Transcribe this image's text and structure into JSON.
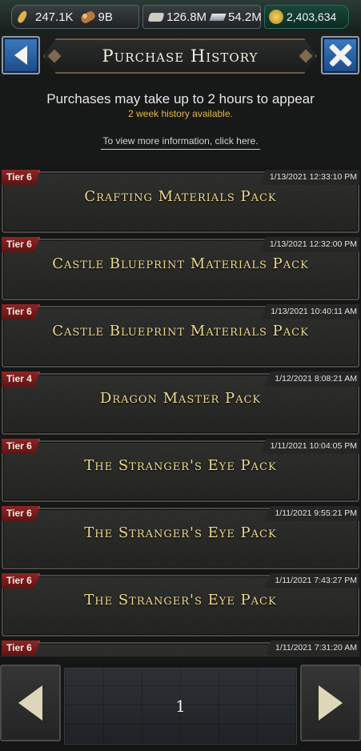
{
  "resources": {
    "food": "247.1K",
    "wood": "9B",
    "stone": "126.8M",
    "iron": "54.2M",
    "gold": "2,403,634"
  },
  "icons": {
    "back": "chevron-left-icon",
    "close": "close-icon",
    "prev_page": "arrow-left-icon",
    "next_page": "arrow-right-icon"
  },
  "header": {
    "title": "Purchase History"
  },
  "info": {
    "notice": "Purchases may take up to 2 hours to appear",
    "history_note": "2 week history available.",
    "more_info_link": "To view more information, click here."
  },
  "purchases": [
    {
      "tier": "Tier 6",
      "date": "1/13/2021 12:33:10 PM",
      "name": "Crafting Materials Pack"
    },
    {
      "tier": "Tier 6",
      "date": "1/13/2021 12:32:00 PM",
      "name": "Castle Blueprint Materials Pack"
    },
    {
      "tier": "Tier 6",
      "date": "1/13/2021 10:40:11 AM",
      "name": "Castle Blueprint Materials Pack"
    },
    {
      "tier": "Tier 4",
      "date": "1/12/2021 8:08:21 AM",
      "name": "Dragon Master Pack"
    },
    {
      "tier": "Tier 6",
      "date": "1/11/2021 10:04:05 PM",
      "name": "The Stranger's Eye Pack"
    },
    {
      "tier": "Tier 6",
      "date": "1/11/2021 9:55:21 PM",
      "name": "The Stranger's Eye Pack"
    },
    {
      "tier": "Tier 6",
      "date": "1/11/2021 7:43:27 PM",
      "name": "The Stranger's Eye Pack"
    },
    {
      "tier": "Tier 6",
      "date": "1/11/2021 7:31:20 AM",
      "name": ""
    }
  ],
  "pagination": {
    "current_page": "1"
  },
  "colors": {
    "tier_badge": "#7a1d1d",
    "pack_name_text": "#f0d98c",
    "history_note_text": "#e3b54a",
    "nav_button": "#2a5fa3",
    "gold_pill": "#17483a"
  }
}
